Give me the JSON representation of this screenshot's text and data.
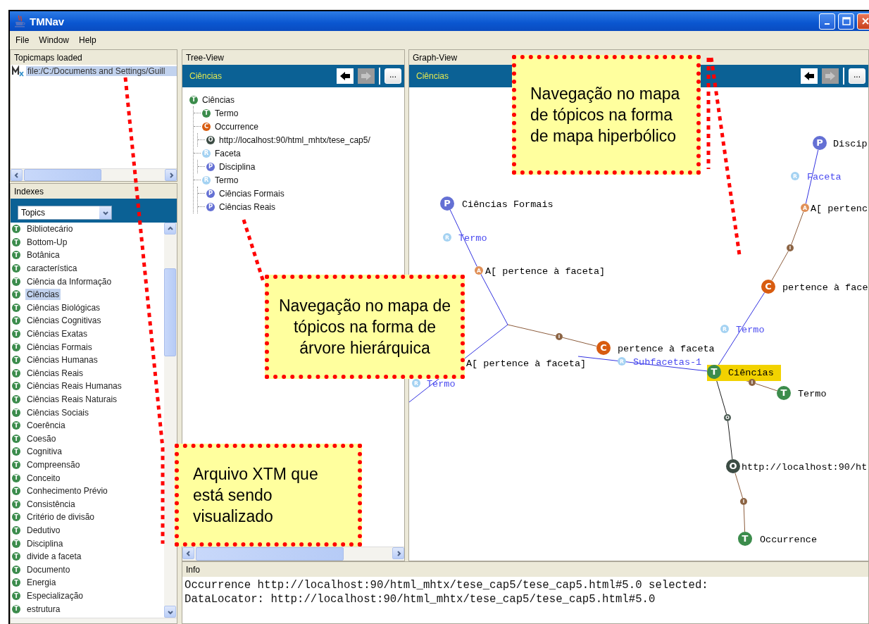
{
  "window": {
    "title": "TMNav"
  },
  "menu": [
    "File",
    "Window",
    "Help"
  ],
  "topicmaps": {
    "title": "Topicmaps loaded",
    "items": [
      {
        "label": "file:/C:/Documents and Settings/Guill",
        "selected": true
      }
    ]
  },
  "indexes": {
    "title": "Indexes",
    "select": "Topics",
    "items": [
      {
        "label": "Bibliotecário",
        "badge": "T",
        "selected": false
      },
      {
        "label": "Bottom-Up",
        "badge": "T",
        "selected": false
      },
      {
        "label": "Botânica",
        "badge": "T",
        "selected": false
      },
      {
        "label": "característica",
        "badge": "T",
        "selected": false
      },
      {
        "label": "Ciência da Informação",
        "badge": "T",
        "selected": false
      },
      {
        "label": "Ciências",
        "badge": "T",
        "selected": true
      },
      {
        "label": "Ciências Biológicas",
        "badge": "T",
        "selected": false
      },
      {
        "label": "Ciências Cognitivas",
        "badge": "T",
        "selected": false
      },
      {
        "label": "Ciências Exatas",
        "badge": "T",
        "selected": false
      },
      {
        "label": "Ciências Formais",
        "badge": "T",
        "selected": false
      },
      {
        "label": "Ciências Humanas",
        "badge": "T",
        "selected": false
      },
      {
        "label": "Ciências Reais",
        "badge": "T",
        "selected": false
      },
      {
        "label": "Ciências Reais Humanas",
        "badge": "T",
        "selected": false
      },
      {
        "label": "Ciências Reais Naturais",
        "badge": "T",
        "selected": false
      },
      {
        "label": "Ciências Sociais",
        "badge": "T",
        "selected": false
      },
      {
        "label": "Coerência",
        "badge": "T",
        "selected": false
      },
      {
        "label": "Coesão",
        "badge": "T",
        "selected": false
      },
      {
        "label": "Cognitiva",
        "badge": "T",
        "selected": false
      },
      {
        "label": "Compreensão",
        "badge": "T",
        "selected": false
      },
      {
        "label": "Conceito",
        "badge": "T",
        "selected": false
      },
      {
        "label": "Conhecimento Prévio",
        "badge": "T",
        "selected": false
      },
      {
        "label": "Consistência",
        "badge": "T",
        "selected": false
      },
      {
        "label": "Critério de divisão",
        "badge": "T",
        "selected": false
      },
      {
        "label": "Dedutivo",
        "badge": "T",
        "selected": false
      },
      {
        "label": "Disciplina",
        "badge": "T",
        "selected": false
      },
      {
        "label": "divide a faceta",
        "badge": "T",
        "selected": false
      },
      {
        "label": "Documento",
        "badge": "T",
        "selected": false
      },
      {
        "label": "Energia",
        "badge": "T",
        "selected": false
      },
      {
        "label": "Especialização",
        "badge": "T",
        "selected": false
      },
      {
        "label": "estrutura",
        "badge": "T",
        "selected": false
      }
    ]
  },
  "tree_view": {
    "title": "Tree-View",
    "current": "Ciências",
    "back": {
      "disabled": false
    },
    "forward": {
      "disabled": true
    },
    "more": "...",
    "nodes": [
      {
        "label": "Ciências",
        "badge": "T",
        "kind": "topic",
        "children": [
          {
            "label": "Termo",
            "badge": "T",
            "kind": "topic"
          },
          {
            "label": "Occurrence",
            "badge": "C",
            "kind": "class",
            "children": [
              {
                "label": "http://localhost:90/html_mhtx/tese_cap5/",
                "badge": "O",
                "kind": "occurrence"
              }
            ]
          },
          {
            "label": "Faceta",
            "badge": "R",
            "kind": "role",
            "children": [
              {
                "label": "Disciplina",
                "badge": "P",
                "kind": "player"
              }
            ]
          },
          {
            "label": "Termo",
            "badge": "R",
            "kind": "role",
            "children": [
              {
                "label": "Ciências Formais",
                "badge": "P",
                "kind": "player"
              },
              {
                "label": "Ciências Reais",
                "badge": "P",
                "kind": "player"
              }
            ]
          }
        ]
      }
    ]
  },
  "graph_view": {
    "title": "Graph-View",
    "current": "Ciências",
    "back": {
      "disabled": false
    },
    "forward": {
      "disabled": true
    },
    "more": "...",
    "nodes": [
      {
        "label": "Ciências Formais",
        "badge": "P",
        "kind": "player",
        "selected": false
      },
      {
        "label": "Termo",
        "badge": "R",
        "kind": "role",
        "selected": false
      },
      {
        "label": "A[ pertence à faceta]",
        "badge": "A",
        "kind": "association",
        "selected": false
      },
      {
        "badge": "I",
        "kind": "instance",
        "selected": false
      },
      {
        "label": "pertence à faceta",
        "badge": "C",
        "kind": "class",
        "selected": false
      },
      {
        "label": "A[ pertence à faceta]",
        "kind": "association",
        "selected": false
      },
      {
        "label": "Termo",
        "badge": "R",
        "kind": "role",
        "selected": false
      },
      {
        "label": "Subfacetas-1",
        "badge": "R",
        "kind": "role",
        "selected": false
      },
      {
        "label": "Termo",
        "badge": "R",
        "kind": "role",
        "selected": false
      },
      {
        "label": "Ciências",
        "badge": "T",
        "kind": "topic",
        "selected": true
      },
      {
        "label": "Discip",
        "badge": "P",
        "kind": "player",
        "selected": false
      },
      {
        "label": "Faceta",
        "badge": "R",
        "kind": "role",
        "selected": false
      },
      {
        "label": "A[ pertenc",
        "badge": "A",
        "kind": "association",
        "selected": false
      },
      {
        "badge": "I",
        "kind": "instance",
        "selected": false
      },
      {
        "label": "pertence à face",
        "badge": "C",
        "kind": "class",
        "selected": false
      },
      {
        "badge": "I",
        "kind": "instance",
        "selected": false
      },
      {
        "label": "Termo",
        "badge": "T",
        "kind": "topic",
        "selected": false
      },
      {
        "badge": "O",
        "kind": "link",
        "selected": false
      },
      {
        "label": "http://localhost:90/ht",
        "badge": "O",
        "kind": "occurrence",
        "selected": false
      },
      {
        "badge": "I",
        "kind": "instance",
        "selected": false
      },
      {
        "label": "Occurrence",
        "badge": "T",
        "kind": "topic",
        "selected": false
      }
    ]
  },
  "info": {
    "title": "Info",
    "lines": [
      "Occurrence http://localhost:90/html_mhtx/tese_cap5/tese_cap5.html#5.0 selected:",
      "DataLocator: http://localhost:90/html_mhtx/tese_cap5/tese_cap5.html#5.0"
    ]
  },
  "callouts": [
    {
      "text": "Navegação no mapa de tópicos na forma de mapa hiperbólico"
    },
    {
      "text": "Navegação no mapa de tópicos na forma de árvore hierárquica"
    },
    {
      "text": "Arquivo XTM que está sendo visualizado"
    }
  ]
}
